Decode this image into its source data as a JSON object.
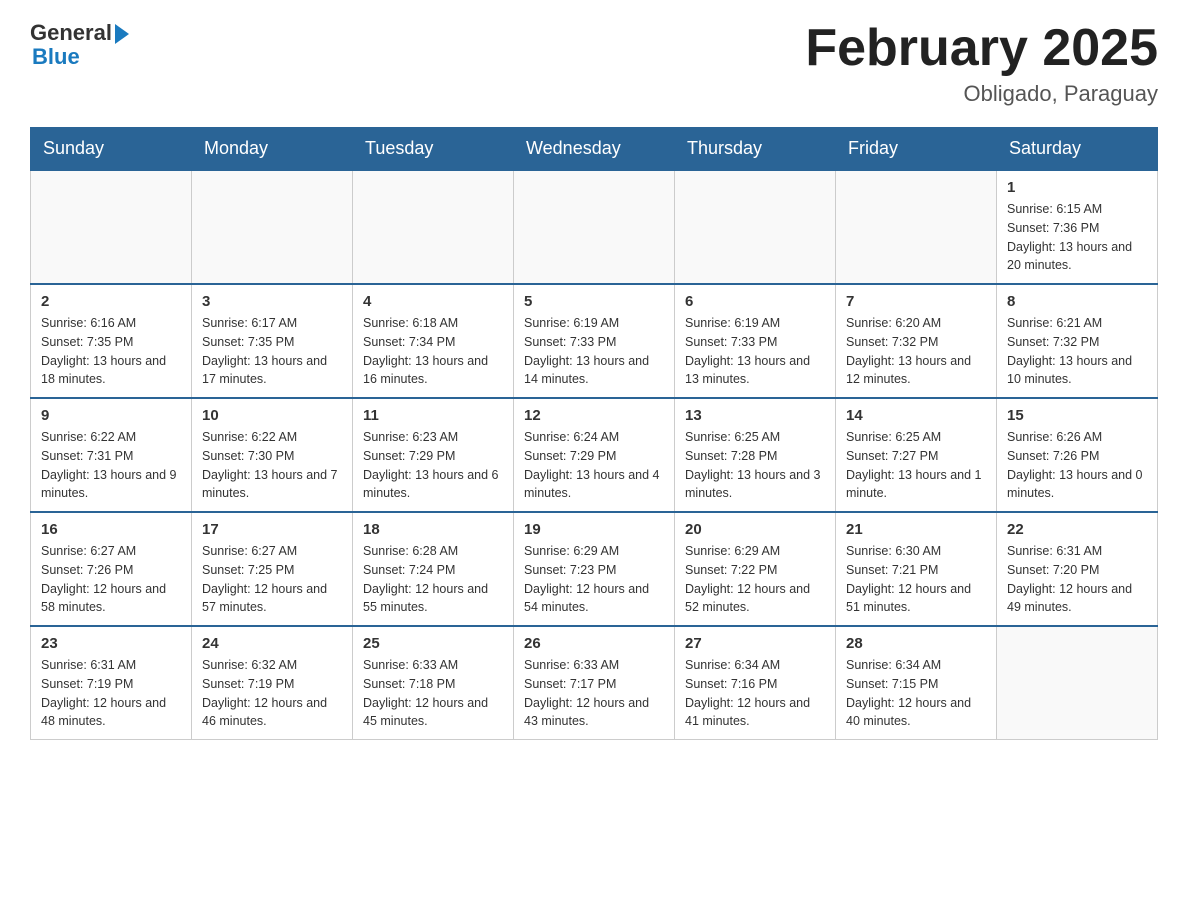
{
  "header": {
    "logo_general": "General",
    "logo_blue": "Blue",
    "month_title": "February 2025",
    "location": "Obligado, Paraguay"
  },
  "days_of_week": [
    "Sunday",
    "Monday",
    "Tuesday",
    "Wednesday",
    "Thursday",
    "Friday",
    "Saturday"
  ],
  "weeks": [
    {
      "cells": [
        {
          "day": "",
          "info": ""
        },
        {
          "day": "",
          "info": ""
        },
        {
          "day": "",
          "info": ""
        },
        {
          "day": "",
          "info": ""
        },
        {
          "day": "",
          "info": ""
        },
        {
          "day": "",
          "info": ""
        },
        {
          "day": "1",
          "info": "Sunrise: 6:15 AM\nSunset: 7:36 PM\nDaylight: 13 hours and 20 minutes."
        }
      ]
    },
    {
      "cells": [
        {
          "day": "2",
          "info": "Sunrise: 6:16 AM\nSunset: 7:35 PM\nDaylight: 13 hours and 18 minutes."
        },
        {
          "day": "3",
          "info": "Sunrise: 6:17 AM\nSunset: 7:35 PM\nDaylight: 13 hours and 17 minutes."
        },
        {
          "day": "4",
          "info": "Sunrise: 6:18 AM\nSunset: 7:34 PM\nDaylight: 13 hours and 16 minutes."
        },
        {
          "day": "5",
          "info": "Sunrise: 6:19 AM\nSunset: 7:33 PM\nDaylight: 13 hours and 14 minutes."
        },
        {
          "day": "6",
          "info": "Sunrise: 6:19 AM\nSunset: 7:33 PM\nDaylight: 13 hours and 13 minutes."
        },
        {
          "day": "7",
          "info": "Sunrise: 6:20 AM\nSunset: 7:32 PM\nDaylight: 13 hours and 12 minutes."
        },
        {
          "day": "8",
          "info": "Sunrise: 6:21 AM\nSunset: 7:32 PM\nDaylight: 13 hours and 10 minutes."
        }
      ]
    },
    {
      "cells": [
        {
          "day": "9",
          "info": "Sunrise: 6:22 AM\nSunset: 7:31 PM\nDaylight: 13 hours and 9 minutes."
        },
        {
          "day": "10",
          "info": "Sunrise: 6:22 AM\nSunset: 7:30 PM\nDaylight: 13 hours and 7 minutes."
        },
        {
          "day": "11",
          "info": "Sunrise: 6:23 AM\nSunset: 7:29 PM\nDaylight: 13 hours and 6 minutes."
        },
        {
          "day": "12",
          "info": "Sunrise: 6:24 AM\nSunset: 7:29 PM\nDaylight: 13 hours and 4 minutes."
        },
        {
          "day": "13",
          "info": "Sunrise: 6:25 AM\nSunset: 7:28 PM\nDaylight: 13 hours and 3 minutes."
        },
        {
          "day": "14",
          "info": "Sunrise: 6:25 AM\nSunset: 7:27 PM\nDaylight: 13 hours and 1 minute."
        },
        {
          "day": "15",
          "info": "Sunrise: 6:26 AM\nSunset: 7:26 PM\nDaylight: 13 hours and 0 minutes."
        }
      ]
    },
    {
      "cells": [
        {
          "day": "16",
          "info": "Sunrise: 6:27 AM\nSunset: 7:26 PM\nDaylight: 12 hours and 58 minutes."
        },
        {
          "day": "17",
          "info": "Sunrise: 6:27 AM\nSunset: 7:25 PM\nDaylight: 12 hours and 57 minutes."
        },
        {
          "day": "18",
          "info": "Sunrise: 6:28 AM\nSunset: 7:24 PM\nDaylight: 12 hours and 55 minutes."
        },
        {
          "day": "19",
          "info": "Sunrise: 6:29 AM\nSunset: 7:23 PM\nDaylight: 12 hours and 54 minutes."
        },
        {
          "day": "20",
          "info": "Sunrise: 6:29 AM\nSunset: 7:22 PM\nDaylight: 12 hours and 52 minutes."
        },
        {
          "day": "21",
          "info": "Sunrise: 6:30 AM\nSunset: 7:21 PM\nDaylight: 12 hours and 51 minutes."
        },
        {
          "day": "22",
          "info": "Sunrise: 6:31 AM\nSunset: 7:20 PM\nDaylight: 12 hours and 49 minutes."
        }
      ]
    },
    {
      "cells": [
        {
          "day": "23",
          "info": "Sunrise: 6:31 AM\nSunset: 7:19 PM\nDaylight: 12 hours and 48 minutes."
        },
        {
          "day": "24",
          "info": "Sunrise: 6:32 AM\nSunset: 7:19 PM\nDaylight: 12 hours and 46 minutes."
        },
        {
          "day": "25",
          "info": "Sunrise: 6:33 AM\nSunset: 7:18 PM\nDaylight: 12 hours and 45 minutes."
        },
        {
          "day": "26",
          "info": "Sunrise: 6:33 AM\nSunset: 7:17 PM\nDaylight: 12 hours and 43 minutes."
        },
        {
          "day": "27",
          "info": "Sunrise: 6:34 AM\nSunset: 7:16 PM\nDaylight: 12 hours and 41 minutes."
        },
        {
          "day": "28",
          "info": "Sunrise: 6:34 AM\nSunset: 7:15 PM\nDaylight: 12 hours and 40 minutes."
        },
        {
          "day": "",
          "info": ""
        }
      ]
    }
  ]
}
